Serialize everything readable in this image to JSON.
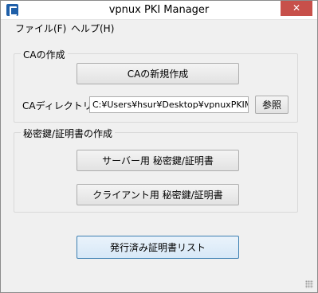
{
  "window": {
    "title": "vpnux PKI Manager",
    "close_label": "✕"
  },
  "menu": {
    "file": "ファイル(F)",
    "help": "ヘルプ(H)"
  },
  "ca_group": {
    "legend": "CAの作成",
    "new_ca_button": "CAの新規作成",
    "directory_label": "CAディレクトリ：",
    "directory_value": "C:¥Users¥hsur¥Desktop¥vpnuxPKIMar",
    "browse_button": "参照"
  },
  "key_group": {
    "legend": "秘密鍵/証明書の作成",
    "server_button": "サーバー用 秘密鍵/証明書",
    "client_button": "クライアント用 秘密鍵/証明書"
  },
  "issued_list_button": "発行済み証明書リスト"
}
